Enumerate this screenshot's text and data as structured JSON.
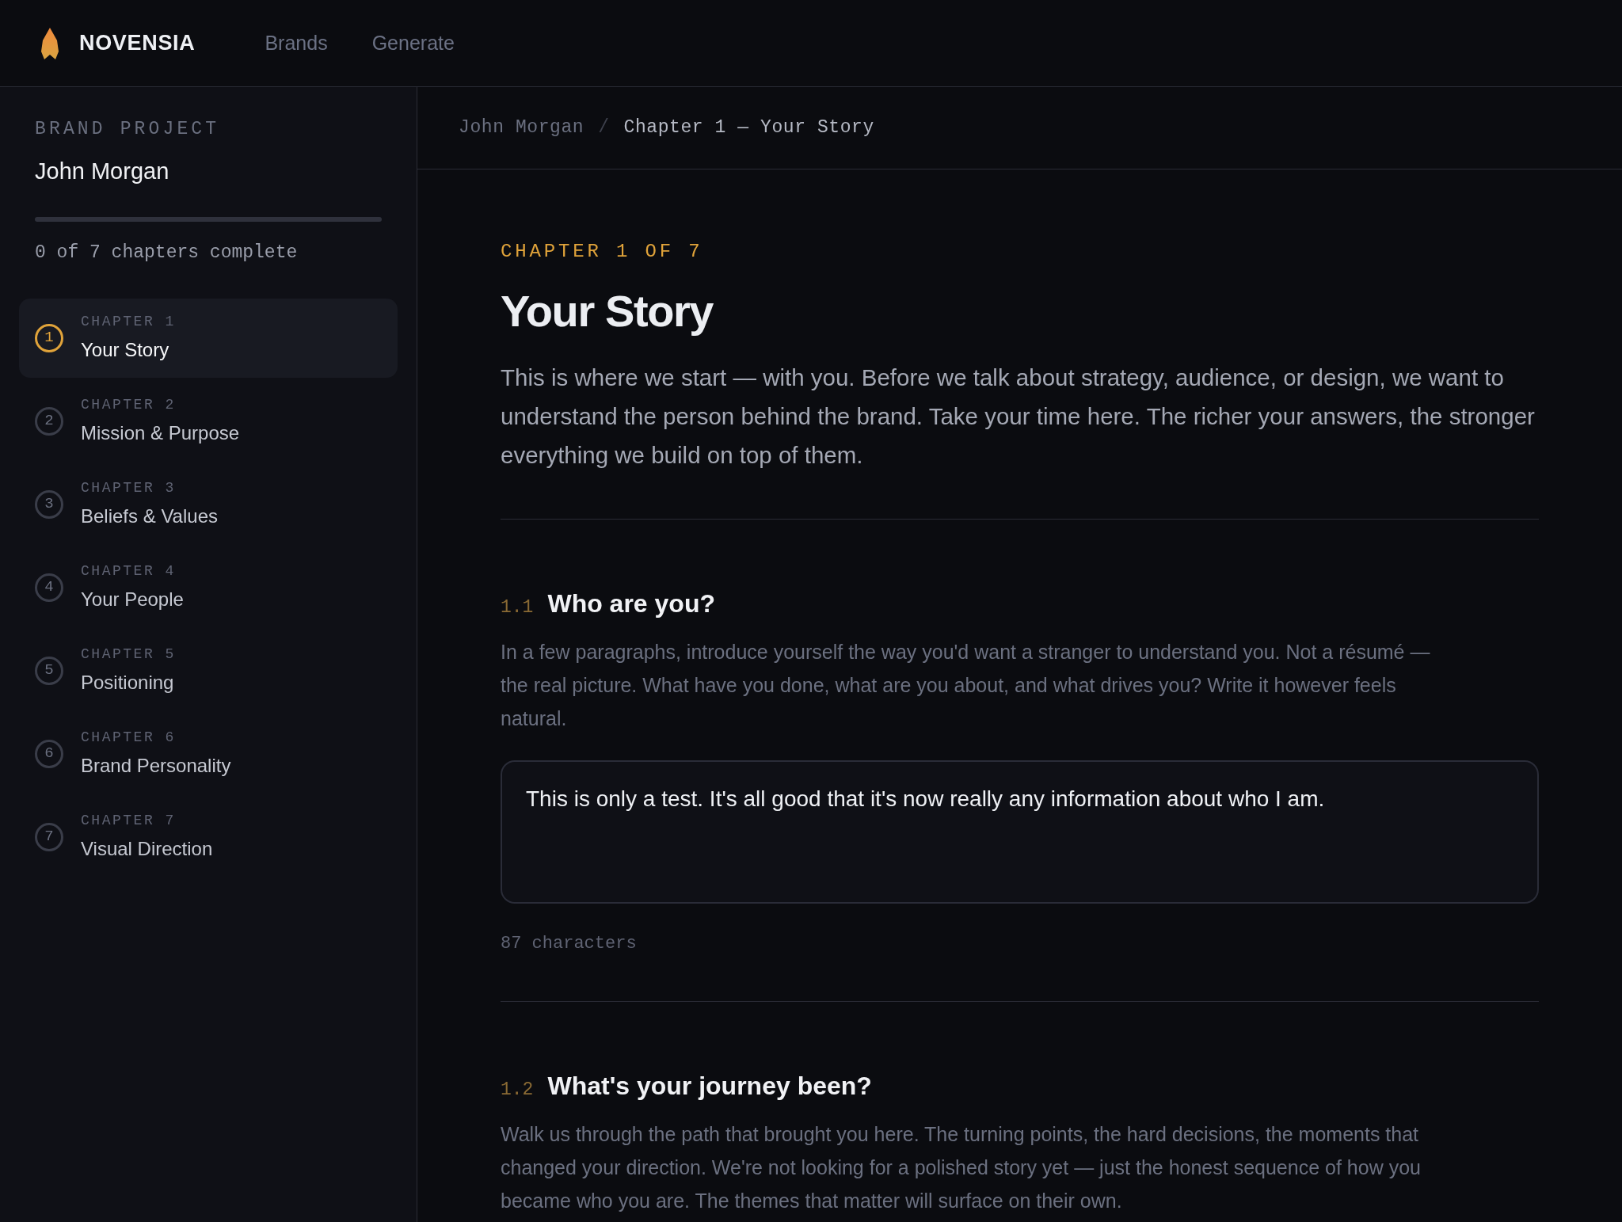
{
  "header": {
    "logo_text": "NOVENSIA",
    "nav": [
      {
        "label": "Brands",
        "selected": false
      },
      {
        "label": "Generate",
        "selected": false
      }
    ]
  },
  "sidebar": {
    "eyebrow": "BRAND PROJECT",
    "project_name": "John Morgan",
    "progress": {
      "level": 0,
      "label": "0 of 7 chapters complete"
    },
    "chapters": [
      {
        "number": "1",
        "eyebrow": "CHAPTER 1",
        "title": "Your Story",
        "selected": true
      },
      {
        "number": "2",
        "eyebrow": "CHAPTER 2",
        "title": "Mission & Purpose",
        "selected": false
      },
      {
        "number": "3",
        "eyebrow": "CHAPTER 3",
        "title": "Beliefs & Values",
        "selected": false
      },
      {
        "number": "4",
        "eyebrow": "CHAPTER 4",
        "title": "Your People",
        "selected": false
      },
      {
        "number": "5",
        "eyebrow": "CHAPTER 5",
        "title": "Positioning",
        "selected": false
      },
      {
        "number": "6",
        "eyebrow": "CHAPTER 6",
        "title": "Brand Personality",
        "selected": false
      },
      {
        "number": "7",
        "eyebrow": "CHAPTER 7",
        "title": "Visual Direction",
        "selected": false
      }
    ]
  },
  "breadcrumb": {
    "items": [
      "John Morgan",
      "Chapter 1 — Your Story"
    ],
    "separator": "/"
  },
  "chapter": {
    "eyebrow": "CHAPTER 1 OF 7",
    "title": "Your Story",
    "intro": "This is where we start — with you. Before we talk about strategy, audience, or design, we want to understand the person behind the brand. Take your time here. The richer your answers, the stronger everything we build on top of them.",
    "questions": [
      {
        "number": "1.1",
        "title": "Who are you?",
        "description": "In a few paragraphs, introduce yourself the way you'd want a stranger to understand you. Not a résumé — the real picture. What have you done, what are you about, and what drives you? Write it however feels natural.",
        "answer": "This is only a test. It's all good that it's now really any information about who I am.",
        "char_count": "87 characters"
      },
      {
        "number": "1.2",
        "title": "What's your journey been?",
        "description": "Walk us through the path that brought you here. The turning points, the hard decisions, the moments that changed your direction. We're not looking for a polished story yet — just the honest sequence of how you became who you are. The themes that matter will surface on their own."
      }
    ]
  }
}
